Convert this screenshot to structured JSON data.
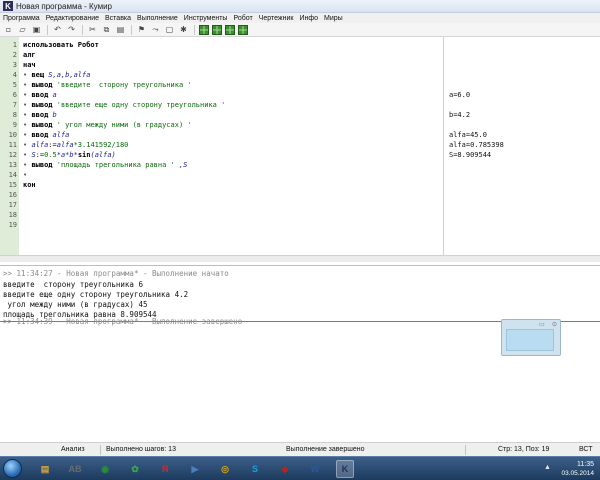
{
  "window": {
    "title": "Новая программа - Кумир",
    "icon_letter": "K"
  },
  "menu": [
    "Программа",
    "Редактирование",
    "Вставка",
    "Выполнение",
    "Инструменты",
    "Робот",
    "Чертежник",
    "Инфо",
    "Миры"
  ],
  "toolbar": {
    "buttons": [
      "new-file-icon",
      "open-file-icon",
      "save-icon",
      "undo-icon",
      "redo-icon",
      "cut-icon",
      "copy-icon",
      "paste-icon",
      "run-icon",
      "step-icon",
      "stop-icon",
      "debug-icon",
      "robot-field-icon",
      "draw-field-icon",
      "grid-icon",
      "grid-icon-2"
    ]
  },
  "editor": {
    "line_numbers": [
      "1",
      "2",
      "3",
      "4",
      "5",
      "6",
      "7",
      "8",
      "9",
      "10",
      "11",
      "12",
      "13",
      "14",
      "15",
      "16",
      "17",
      "18",
      "19"
    ],
    "lines": [
      [
        {
          "t": "использовать Робот",
          "c": "kw"
        }
      ],
      [
        {
          "t": "алг",
          "c": "kw"
        }
      ],
      [
        {
          "t": "нач",
          "c": "kw"
        }
      ],
      [
        {
          "t": "• ",
          "c": "bullet"
        },
        {
          "t": "вещ ",
          "c": "kw"
        },
        {
          "t": "S,a,b,alfa",
          "c": "it"
        }
      ],
      [
        {
          "t": "• ",
          "c": "bullet"
        },
        {
          "t": "вывод ",
          "c": "kw"
        },
        {
          "t": "'введите  сторону треугольника '",
          "c": "str"
        }
      ],
      [
        {
          "t": "• ",
          "c": "bullet"
        },
        {
          "t": "ввод ",
          "c": "kw"
        },
        {
          "t": "a",
          "c": "it"
        }
      ],
      [
        {
          "t": "• ",
          "c": "bullet"
        },
        {
          "t": "вывод ",
          "c": "kw"
        },
        {
          "t": "'введите еще одну сторону треугольника '",
          "c": "str"
        }
      ],
      [
        {
          "t": "• ",
          "c": "bullet"
        },
        {
          "t": "ввод ",
          "c": "kw"
        },
        {
          "t": "b",
          "c": "it"
        }
      ],
      [
        {
          "t": "• ",
          "c": "bullet"
        },
        {
          "t": "вывод ",
          "c": "kw"
        },
        {
          "t": "' угол между ними (в градусах) '",
          "c": "str"
        }
      ],
      [
        {
          "t": "• ",
          "c": "bullet"
        },
        {
          "t": "ввод ",
          "c": "kw"
        },
        {
          "t": "alfa",
          "c": "it"
        }
      ],
      [
        {
          "t": "• ",
          "c": "bullet"
        },
        {
          "t": "alfa",
          "c": "it"
        },
        {
          "t": ":=",
          "c": "plain"
        },
        {
          "t": "alfa",
          "c": "it"
        },
        {
          "t": "*3.141592/180",
          "c": "str"
        }
      ],
      [
        {
          "t": "• ",
          "c": "bullet"
        },
        {
          "t": "S",
          "c": "it"
        },
        {
          "t": ":=",
          "c": "plain"
        },
        {
          "t": "0.5",
          "c": "str"
        },
        {
          "t": "*a*b*",
          "c": "it"
        },
        {
          "t": "sin",
          "c": "kw"
        },
        {
          "t": "(alfa)",
          "c": "it"
        }
      ],
      [
        {
          "t": "• ",
          "c": "bullet"
        },
        {
          "t": "вывод ",
          "c": "kw"
        },
        {
          "t": "'площадь трегольника равна ' ",
          "c": "str"
        },
        {
          "t": ",S",
          "c": "it"
        }
      ],
      [
        {
          "t": "•",
          "c": "bullet"
        }
      ],
      [
        {
          "t": "кон",
          "c": "kw"
        }
      ],
      [],
      [],
      [],
      []
    ],
    "margin": [
      {
        "line": 6,
        "text": "a=6.0"
      },
      {
        "line": 8,
        "text": "b=4.2"
      },
      {
        "line": 10,
        "text": "alfa=45.0"
      },
      {
        "line": 11,
        "text": "alfa=0.785398"
      },
      {
        "line": 12,
        "text": "S=8.909544"
      }
    ]
  },
  "output": {
    "lines": [
      {
        "text": ">> 11:34:27 - Новая программа* - Выполнение начато",
        "kind": "log"
      },
      {
        "text": "введите  сторону треугольника 6",
        "kind": "out"
      },
      {
        "text": "введите еще одну сторону треугольника 4.2",
        "kind": "out"
      },
      {
        "text": " угол между ними (в градусах) 45",
        "kind": "out"
      },
      {
        "text": "площадь трегольника равна 8.909544",
        "kind": "out"
      },
      {
        "text": ">> 11:34:39 - Новая программа* - Выполнение завершено",
        "kind": "log"
      }
    ]
  },
  "status": {
    "analysis": "Анализ",
    "steps": "Выполнено шагов: 13",
    "state": "Выполнение завершено",
    "position": "Стр: 13, Поз: 19",
    "mode": "ВСТ"
  },
  "taskbar": {
    "apps": [
      {
        "name": "explorer-icon",
        "glyph": "▤",
        "color": "#d8a33b"
      },
      {
        "name": "abbyy-icon",
        "glyph": "AB",
        "color": "#6b6b6b"
      },
      {
        "name": "media-icon",
        "glyph": "◉",
        "color": "#2a8f3a"
      },
      {
        "name": "clover-icon",
        "glyph": "✿",
        "color": "#3aa64a"
      },
      {
        "name": "yandex-icon",
        "glyph": "Я",
        "color": "#d22b2b"
      },
      {
        "name": "player-icon",
        "glyph": "▶",
        "color": "#4a7fc0"
      },
      {
        "name": "chrome-icon",
        "glyph": "◎",
        "color": "#d4a417"
      },
      {
        "name": "skype-icon",
        "glyph": "S",
        "color": "#1aa0e0"
      },
      {
        "name": "pdf-icon",
        "glyph": "◆",
        "color": "#b3261e"
      },
      {
        "name": "word-icon",
        "glyph": "W",
        "color": "#2b579a"
      },
      {
        "name": "kumir-icon",
        "glyph": "K",
        "color": "#2d2d5a",
        "active": true
      }
    ],
    "clock_time": "11:35",
    "clock_date": "03.05.2014"
  }
}
